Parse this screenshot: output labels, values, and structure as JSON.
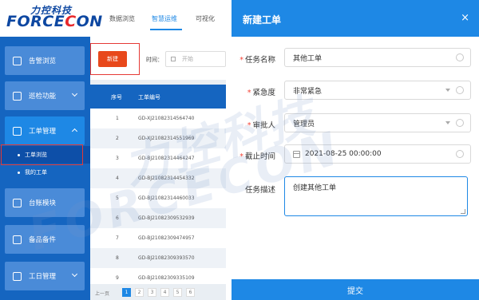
{
  "logo": {
    "cn": "力控科技",
    "en_prefix": "FORCE",
    "en_c": "C",
    "en_suffix": "ON"
  },
  "topnav": [
    "数据浏览",
    "智慧运维",
    "可视化"
  ],
  "sidebar": {
    "items": [
      {
        "label": "告警浏览",
        "icon": "alarm-icon"
      },
      {
        "label": "巡检功能",
        "icon": "inspection-icon"
      },
      {
        "label": "工单管理",
        "icon": "work-order-icon"
      },
      {
        "label": "台账模块",
        "icon": "ledger-icon"
      },
      {
        "label": "备品备件",
        "icon": "spare-parts-icon"
      },
      {
        "label": "工日管理",
        "icon": "workday-icon"
      }
    ],
    "submenu": [
      "工单浏览",
      "我的工单"
    ]
  },
  "toolbar": {
    "new_label": "新建",
    "time_label": "时间：",
    "start_placeholder": "开始"
  },
  "table": {
    "headers": [
      "序号",
      "工单编号"
    ],
    "rows": [
      [
        "1",
        "GD-XJ21082314564740"
      ],
      [
        "2",
        "GD-XJ21082314551969"
      ],
      [
        "3",
        "GD-BJ21082314464247"
      ],
      [
        "4",
        "GD-BJ21082314454332"
      ],
      [
        "5",
        "GD-BJ21082314460033"
      ],
      [
        "6",
        "GD-BJ21082309532939"
      ],
      [
        "7",
        "GD-BJ21082309474957"
      ],
      [
        "8",
        "GD-BJ21082309393570"
      ],
      [
        "9",
        "GD-BJ21082309335109"
      ]
    ]
  },
  "pager": {
    "prev": "上一页",
    "pages": [
      "1",
      "2",
      "3",
      "4",
      "5",
      "6"
    ]
  },
  "watermark": [
    "力控科技",
    "FORCECON"
  ],
  "dialog": {
    "title": "新建工单",
    "close": "×",
    "fields": {
      "task_name": {
        "label": "任务名称",
        "value": "其他工单",
        "required": true
      },
      "urgency": {
        "label": "紧急度",
        "value": "非常紧急",
        "required": true
      },
      "approver": {
        "label": "审批人",
        "value": "管理员",
        "required": true
      },
      "deadline": {
        "label": "截止时间",
        "value": "2021-08-25 00:00:00",
        "required": true
      },
      "description": {
        "label": "任务描述",
        "value": "创建其他工单",
        "required": false
      }
    },
    "submit": "提交"
  },
  "colors": {
    "primary": "#1e88e5",
    "sidebar": "#1565c0",
    "danger": "#e8481b",
    "highlight_box": "#e53935"
  }
}
